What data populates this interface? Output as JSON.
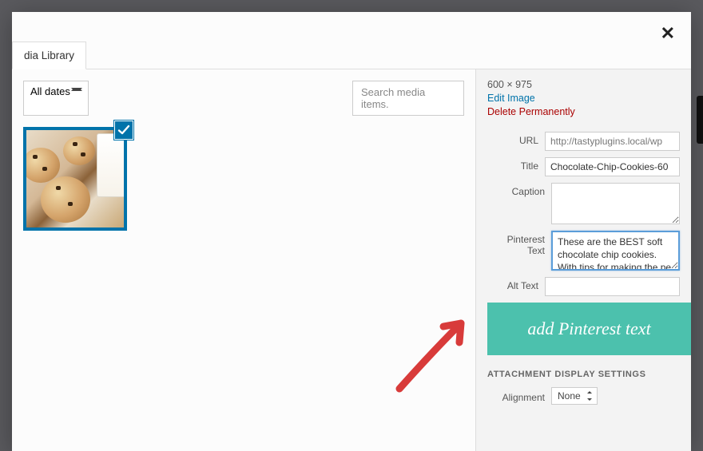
{
  "tab_label": "dia Library",
  "close_glyph": "✕",
  "toolbar": {
    "date_filter": "All dates",
    "search_placeholder": "Search media items."
  },
  "thumbnail": {
    "alt": "Chocolate chip cookies thumbnail"
  },
  "details": {
    "dimensions": "600 × 975",
    "edit_link": "Edit Image",
    "delete_link": "Delete Permanently",
    "url_label": "URL",
    "url_value": "http://tastyplugins.local/wp",
    "title_label": "Title",
    "title_value": "Chocolate-Chip-Cookies-60",
    "caption_label": "Caption",
    "caption_value": "",
    "pinterest_label": "Pinterest Text",
    "pinterest_value": "These are the BEST soft chocolate chip cookies. With tips for making the pe",
    "alt_label": "Alt Text",
    "alt_value": ""
  },
  "callout_text": "add Pinterest text",
  "attachment": {
    "header": "ATTACHMENT DISPLAY SETTINGS",
    "alignment_label": "Alignment",
    "alignment_value": "None"
  }
}
